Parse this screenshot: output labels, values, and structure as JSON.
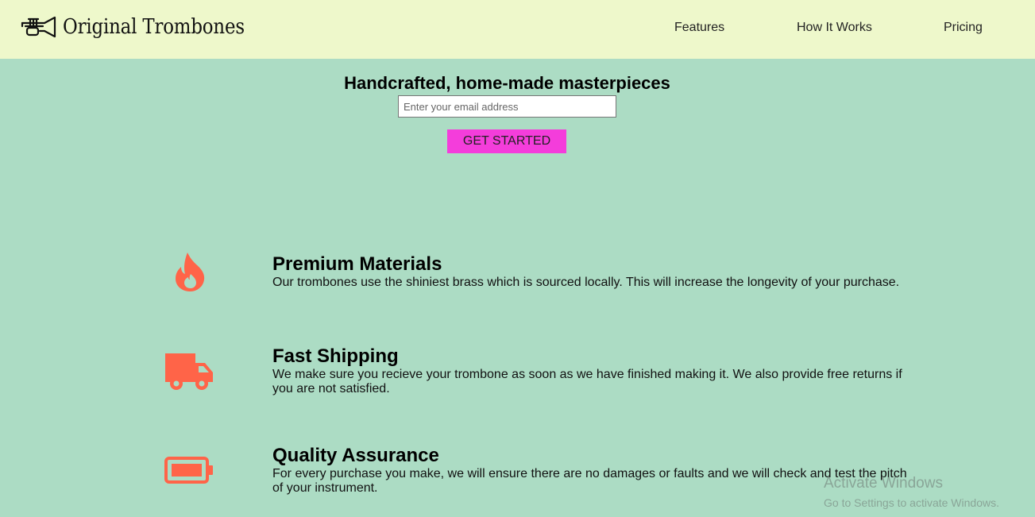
{
  "header": {
    "logo_icon": "trumpet-icon",
    "brand": "Original Trombones",
    "nav": [
      {
        "label": "Features"
      },
      {
        "label": "How It Works"
      },
      {
        "label": "Pricing"
      }
    ]
  },
  "hero": {
    "title": "Handcrafted, home-made masterpieces",
    "email_placeholder": "Enter your email address",
    "email_value": "",
    "button_label": "GET STARTED",
    "button_color": "#f43ddb"
  },
  "features": [
    {
      "icon": "fire-icon",
      "title": "Premium Materials",
      "description": "Our trombones use the shiniest brass which is sourced locally. This will increase the longevity of your purchase."
    },
    {
      "icon": "truck-icon",
      "title": "Fast Shipping",
      "description": "We make sure you recieve your trombone as soon as we have finished making it. We also provide free returns if you are not satisfied."
    },
    {
      "icon": "battery-icon",
      "title": "Quality Assurance",
      "description": "For every purchase you make, we will ensure there are no damages or faults and we will check and test the pitch of your instrument."
    }
  ],
  "watermark": {
    "title": "Activate Windows",
    "subtitle": "Go to Settings to activate Windows."
  },
  "colors": {
    "header_bg": "#eef8cb",
    "page_bg": "#acdcc4",
    "icon_accent": "#ff6448"
  }
}
